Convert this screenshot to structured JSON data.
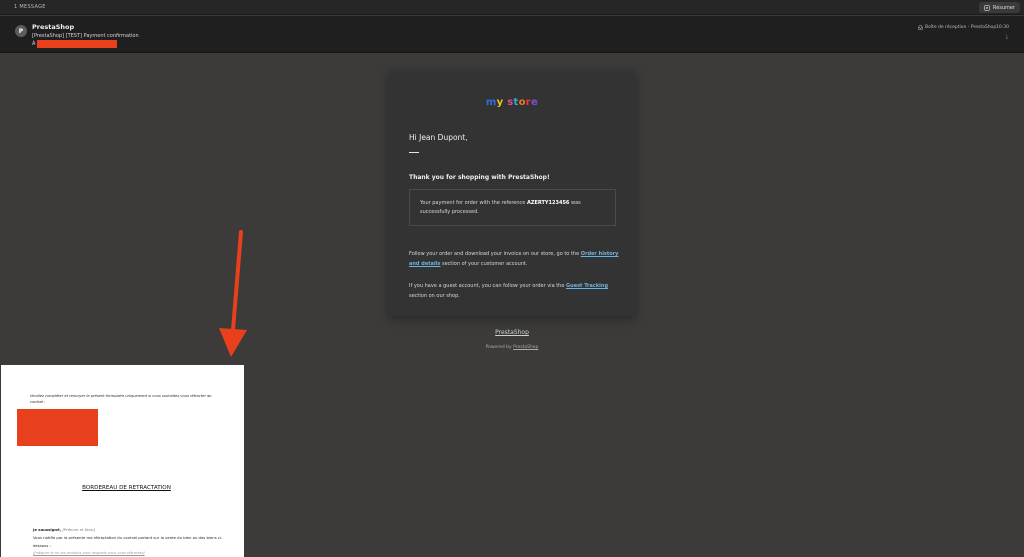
{
  "topbar": {
    "message_count": "1 MESSAGE",
    "summarize_label": "Résumer"
  },
  "message": {
    "avatar_letter": "P",
    "sender": "PrestaShop",
    "subject": "[PrestaShop] [TEST] Payment confirmation",
    "to_prefix": "À",
    "folder": "Boîte de réception - PrestaShop",
    "time": "10:30"
  },
  "email": {
    "logo_letters": [
      "m",
      "y",
      " ",
      "s",
      "t",
      "o",
      "r",
      "e"
    ],
    "greeting": "Hi Jean Dupont,",
    "thanks": "Thank you for shopping with PrestaShop!",
    "payment_pre": "Your payment for order with the reference ",
    "payment_ref": "AZERTY123456",
    "payment_post": " was successfully processed.",
    "follow_pre": "Follow your order and download your invoice on our store, go to the ",
    "follow_link": "Order history and details",
    "follow_post": " section of your customer account.",
    "guest_pre": "If you have a guest account, you can follow your order via the ",
    "guest_link": "Guest Tracking",
    "guest_post": " section on our shop.",
    "footer_name": "PrestaShop",
    "powered_pre": "Powered by ",
    "powered_link": "PrestaShop"
  },
  "document": {
    "intro": "Veuillez compléter et renvoyer le présent formulaire uniquement si vous souhaitez vous rétracter du contrat :",
    "title": "BORDEREAU DE RETRACTATION",
    "line1_label": "Je soussigné,",
    "line1_hint": "[Prénom et Nom]",
    "line2": "Vous notifie par la présente ma rétractation du contrat portant sur la vente du bien ou des biens ci-dessous :",
    "line3": "[Indiquer le ou les produits pour lesquels vous vous rétractez]"
  },
  "colors": {
    "redaction": "#e8401c",
    "link": "#6fb2e0"
  }
}
